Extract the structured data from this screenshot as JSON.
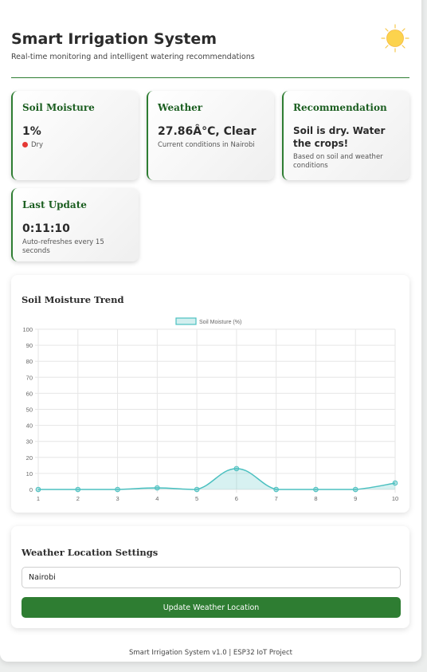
{
  "header": {
    "title": "Smart Irrigation System",
    "subtitle": "Real-time monitoring and intelligent watering recommendations",
    "icon": "sun-icon"
  },
  "cards": {
    "soil": {
      "title": "Soil Moisture",
      "value": "1%",
      "status": "Dry",
      "status_color": "#e53935"
    },
    "weather": {
      "title": "Weather",
      "value": "27.86Â°C, Clear",
      "note": "Current conditions in Nairobi"
    },
    "recommendation": {
      "title": "Recommendation",
      "value": "Soil is dry. Water the crops!",
      "note": "Based on soil and weather conditions"
    },
    "last_update": {
      "title": "Last Update",
      "value": "0:11:10",
      "note": "Auto-refreshes every 15 seconds"
    }
  },
  "trend": {
    "heading": "Soil Moisture Trend"
  },
  "chart_data": {
    "type": "line",
    "x": [
      1,
      2,
      3,
      4,
      5,
      6,
      7,
      8,
      9,
      10
    ],
    "series": [
      {
        "name": "Soil Moisture (%)",
        "values": [
          0,
          0,
          0,
          1,
          0,
          13,
          0,
          0,
          0,
          4
        ]
      }
    ],
    "ylim": [
      0,
      100
    ],
    "yticks": [
      0,
      10,
      20,
      30,
      40,
      50,
      60,
      70,
      80,
      90,
      100
    ],
    "grid": true,
    "fill": true,
    "legend_position": "top",
    "line_color": "#4bc0c0"
  },
  "location": {
    "heading": "Weather Location Settings",
    "input_value": "Nairobi",
    "button_label": "Update Weather Location"
  },
  "footer": "Smart Irrigation System v1.0 | ESP32 IoT Project",
  "colors": {
    "accent": "#2e7d32",
    "card_title": "#1b5e20"
  }
}
